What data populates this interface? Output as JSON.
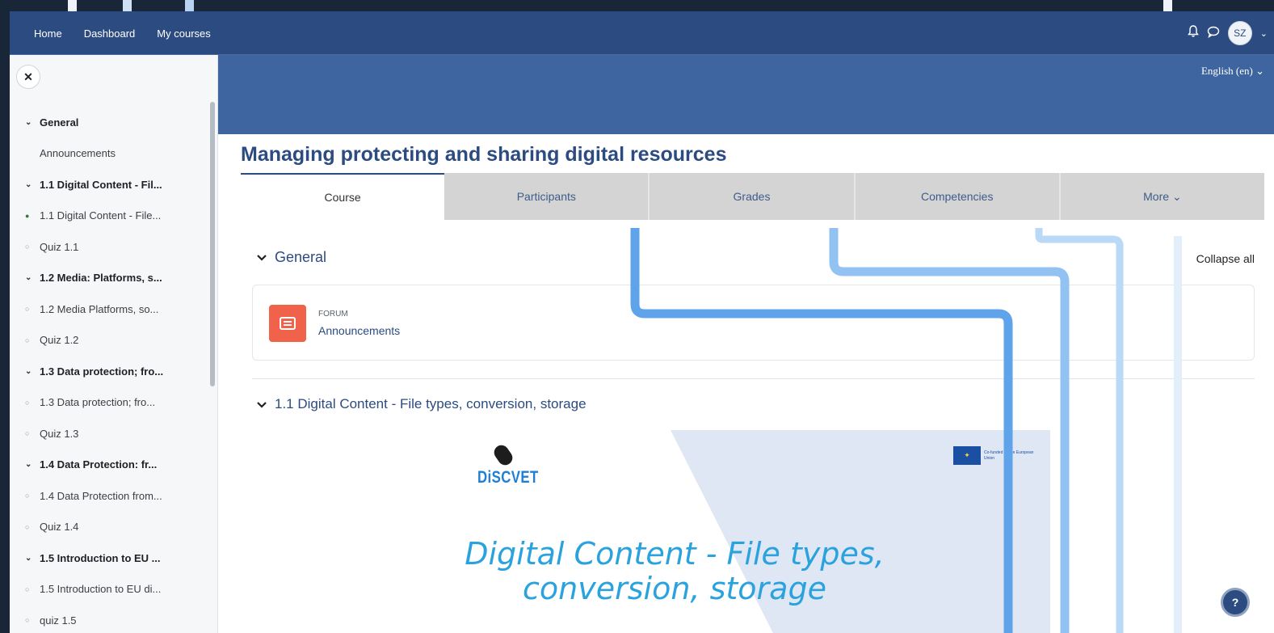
{
  "navbar": {
    "links": [
      "Home",
      "Dashboard",
      "My courses"
    ],
    "avatar_initials": "SZ",
    "notification_icon": "bell-icon",
    "message_icon": "chat-bubble-icon"
  },
  "sidebar": {
    "close_icon": "close-icon",
    "items": [
      {
        "type": "section",
        "label": "General"
      },
      {
        "type": "plain",
        "label": "Announcements"
      },
      {
        "type": "section",
        "label": "1.1 Digital Content - Fil..."
      },
      {
        "type": "activity",
        "label": "1.1 Digital Content - File...",
        "done": true
      },
      {
        "type": "activity",
        "label": "Quiz 1.1",
        "done": false
      },
      {
        "type": "section",
        "label": "1.2 Media: Platforms, s..."
      },
      {
        "type": "activity",
        "label": "1.2 Media Platforms, so...",
        "done": false
      },
      {
        "type": "activity",
        "label": "Quiz 1.2",
        "done": false
      },
      {
        "type": "section",
        "label": "1.3 Data protection; fro..."
      },
      {
        "type": "activity",
        "label": "1.3 Data protection; fro...",
        "done": false
      },
      {
        "type": "activity",
        "label": "Quiz 1.3",
        "done": false
      },
      {
        "type": "section",
        "label": "1.4 Data Protection: fr..."
      },
      {
        "type": "activity",
        "label": "1.4 Data Protection from...",
        "done": false
      },
      {
        "type": "activity",
        "label": "Quiz 1.4",
        "done": false
      },
      {
        "type": "section",
        "label": "1.5 Introduction to EU ..."
      },
      {
        "type": "activity",
        "label": "1.5 Introduction to EU di...",
        "done": false
      },
      {
        "type": "activity",
        "label": "quiz 1.5",
        "done": false
      }
    ]
  },
  "header": {
    "language": "English (en)",
    "course_title": "Managing protecting and sharing digital resources"
  },
  "tabs": [
    "Course",
    "Participants",
    "Grades",
    "Competencies",
    "More"
  ],
  "content": {
    "general_section": "General",
    "collapse_all": "Collapse all",
    "forum_type": "FORUM",
    "forum_name": "Announcements",
    "section_1_1": "1.1 Digital Content - File types, conversion, storage",
    "banner": {
      "logo_text": "DiSCVET",
      "eu_text": "Co-funded by the European Union",
      "title_line1": "Digital Content - File types,",
      "title_line2": "conversion, storage"
    },
    "help_label": "?"
  },
  "colors": {
    "navbar": "#2c4b80",
    "hero": "#3e659f",
    "accent_title": "#2aa2de",
    "forum_icon": "#f0624a"
  }
}
